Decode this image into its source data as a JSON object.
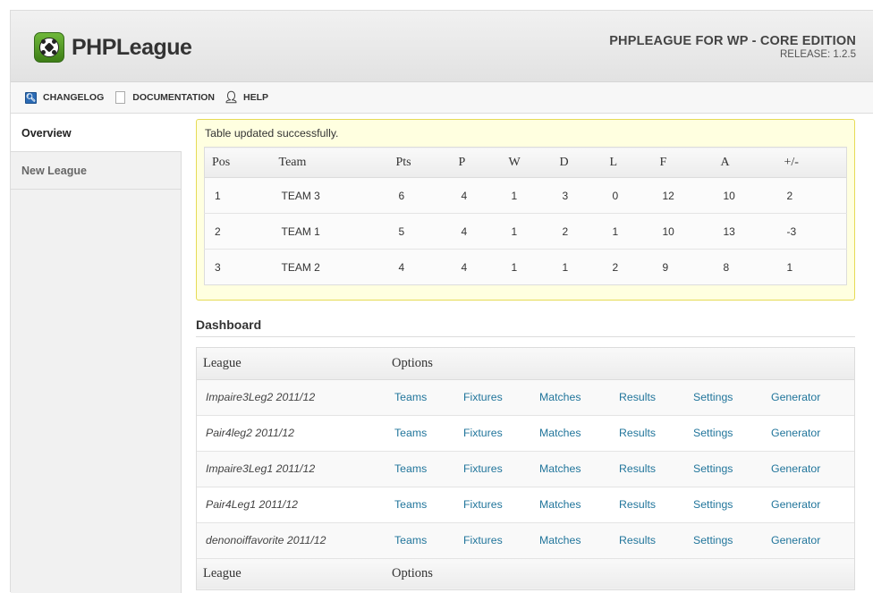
{
  "header": {
    "logo_text": "PHPLeague",
    "edition_title": "PHPLEAGUE FOR WP - CORE EDITION",
    "release": "RELEASE: 1.2.5"
  },
  "toolbar": {
    "changelog": "CHANGELOG",
    "documentation": "DOCUMENTATION",
    "help": "HELP"
  },
  "sidebar": {
    "items": [
      {
        "label": "Overview"
      },
      {
        "label": "New League"
      }
    ]
  },
  "notice": {
    "message": "Table updated successfully."
  },
  "standings": {
    "headers": [
      "Pos",
      "Team",
      "Pts",
      "P",
      "W",
      "D",
      "L",
      "F",
      "A",
      "+/-"
    ],
    "rows": [
      [
        "1",
        "TEAM 3",
        "6",
        "4",
        "1",
        "3",
        "0",
        "12",
        "10",
        "2"
      ],
      [
        "2",
        "TEAM 1",
        "5",
        "4",
        "1",
        "2",
        "1",
        "10",
        "13",
        "-3"
      ],
      [
        "3",
        "TEAM 2",
        "4",
        "4",
        "1",
        "1",
        "2",
        "9",
        "8",
        "1"
      ]
    ]
  },
  "dashboard": {
    "title": "Dashboard",
    "headers": [
      "League",
      "Options"
    ],
    "footers": [
      "League",
      "Options"
    ],
    "option_labels": [
      "Teams",
      "Fixtures",
      "Matches",
      "Results",
      "Settings",
      "Generator"
    ],
    "leagues": [
      {
        "name": "Impaire3Leg2 2011/12"
      },
      {
        "name": "Pair4leg2 2011/12"
      },
      {
        "name": "Impaire3Leg1 2011/12"
      },
      {
        "name": "Pair4Leg1 2011/12"
      },
      {
        "name": "denonoiffavorite 2011/12"
      }
    ]
  },
  "colors": {
    "link": "#21759b",
    "notice_bg": "#ffffe0",
    "notice_border": "#e6db55",
    "logo_green": "#4f9a24"
  },
  "icons": {
    "logo": "soccer-ball-icon",
    "changelog": "search-icon",
    "documentation": "document-icon",
    "help": "person-icon"
  }
}
